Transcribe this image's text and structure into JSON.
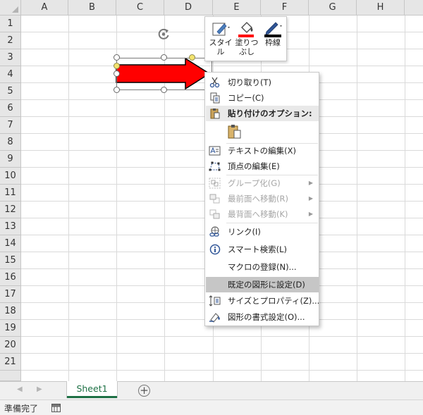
{
  "columns": [
    "A",
    "B",
    "C",
    "D",
    "E",
    "F",
    "G",
    "H"
  ],
  "rows": [
    "1",
    "2",
    "3",
    "4",
    "5",
    "6",
    "7",
    "8",
    "9",
    "10",
    "11",
    "12",
    "13",
    "14",
    "15",
    "16",
    "17",
    "18",
    "19",
    "20",
    "21"
  ],
  "mini_toolbar": {
    "style_label": "スタイル",
    "fill_label": "塗りつぶし",
    "fill_color": "#ff0000",
    "outline_label": "枠線",
    "outline_color": "#000000"
  },
  "shape": {
    "fill": "#ff0000",
    "stroke": "#000000",
    "kind": "right-arrow"
  },
  "context_menu": {
    "items": [
      {
        "label": "切り取り(T)",
        "icon": "scissors-icon",
        "disabled": false
      },
      {
        "label": "コピー(C)",
        "icon": "copy-icon",
        "disabled": false
      },
      {
        "label": "貼り付けのオプション:",
        "icon": "paste-icon",
        "header": true
      },
      {
        "label": "",
        "icon": "paste-option-icon"
      },
      {
        "label": "テキストの編集(X)",
        "icon": "edit-text-icon",
        "disabled": false
      },
      {
        "label": "頂点の編集(E)",
        "icon": "edit-points-icon",
        "disabled": false
      },
      {
        "label": "グループ化(G)",
        "icon": "group-icon",
        "disabled": true,
        "submenu": true
      },
      {
        "label": "最前面へ移動(R)",
        "icon": "bring-front-icon",
        "disabled": true,
        "submenu": true
      },
      {
        "label": "最背面へ移動(K)",
        "icon": "send-back-icon",
        "disabled": true,
        "submenu": true
      },
      {
        "label": "リンク(I)",
        "icon": "link-icon",
        "disabled": false
      },
      {
        "label": "スマート検索(L)",
        "icon": "smart-lookup-icon",
        "disabled": false
      },
      {
        "label": "マクロの登録(N)...",
        "icon": "",
        "disabled": false
      },
      {
        "label": "既定の図形に設定(D)",
        "icon": "",
        "disabled": false,
        "highlighted": true
      },
      {
        "label": "サイズとプロパティ(Z)...",
        "icon": "size-properties-icon",
        "disabled": false
      },
      {
        "label": "図形の書式設定(O)...",
        "icon": "format-shape-icon",
        "disabled": false
      }
    ]
  },
  "sheet_tab": "Sheet1",
  "add_sheet": "+",
  "status_text": "準備完了",
  "accent_color": "#1e7145"
}
